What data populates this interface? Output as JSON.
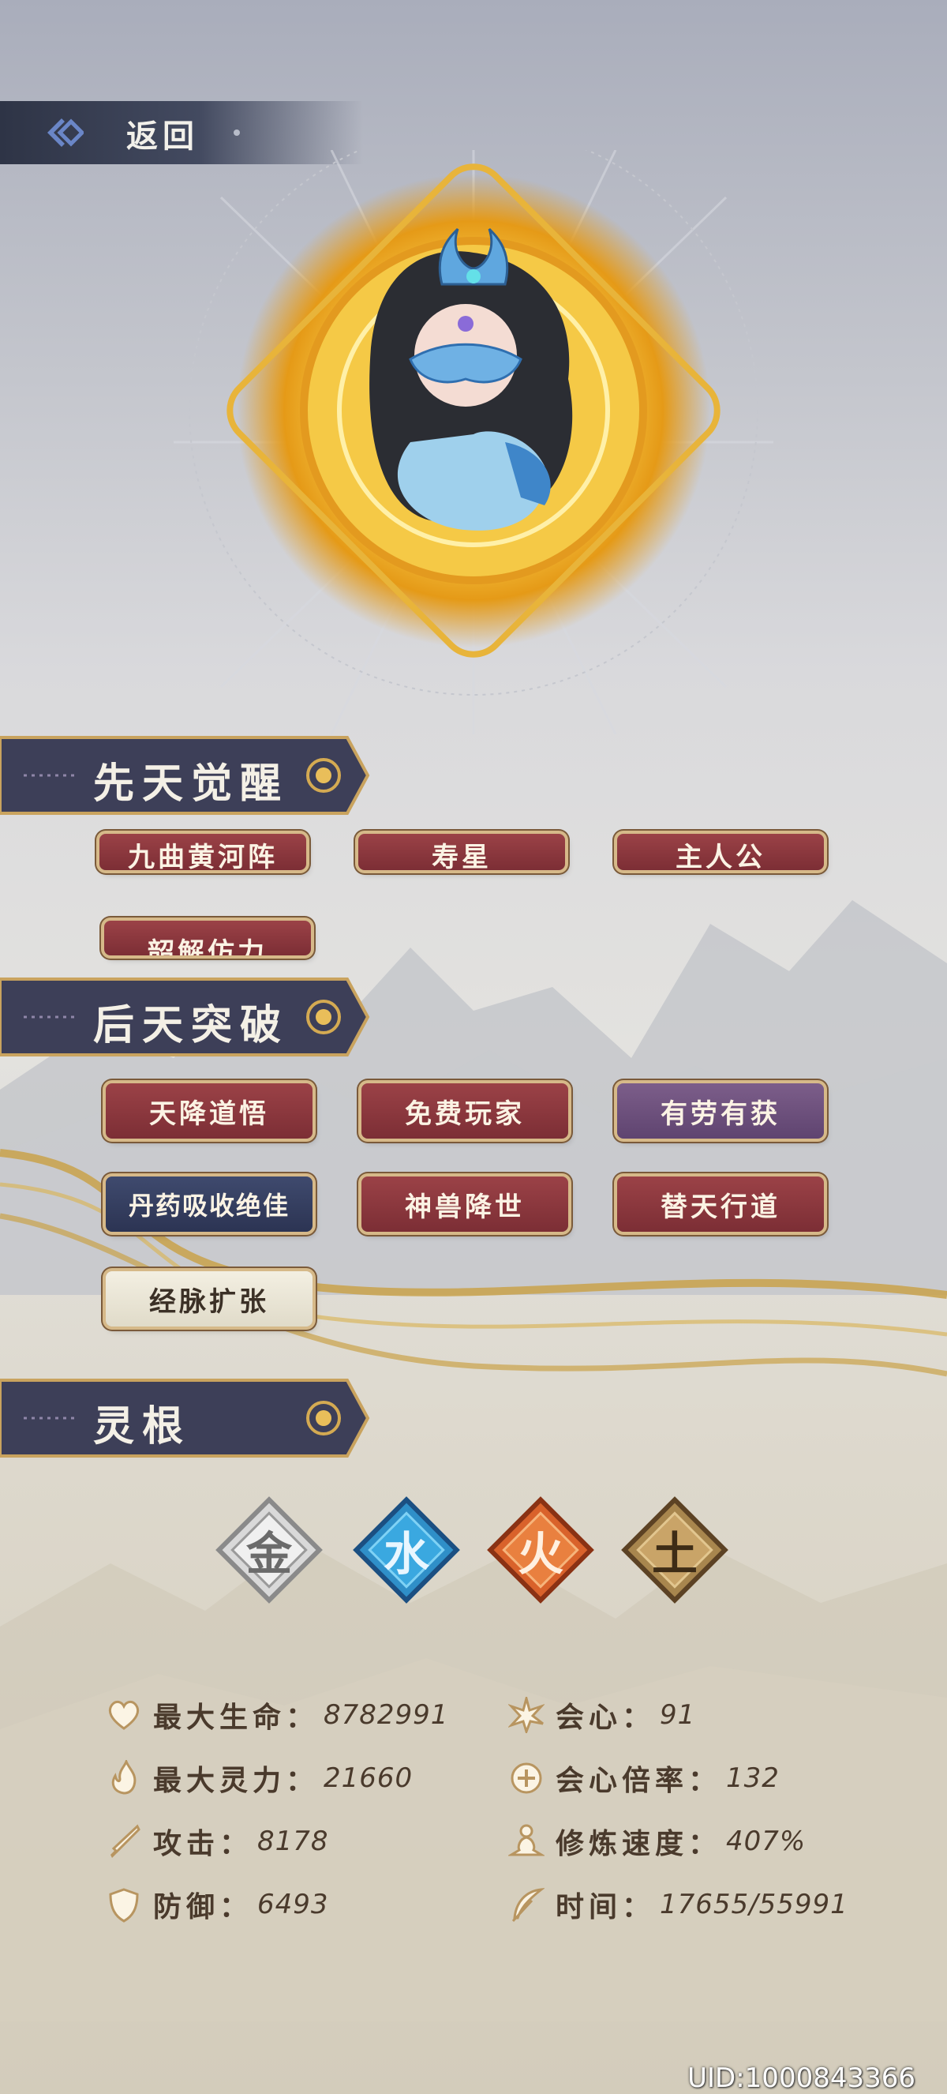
{
  "nav": {
    "back_label": "返回"
  },
  "sections": {
    "innate": "先天觉醒",
    "acquired": "后天突破",
    "spirit_root": "灵根"
  },
  "innate_skills": [
    {
      "label": "九曲黄河阵",
      "style": "red"
    },
    {
      "label": "寿星",
      "style": "red"
    },
    {
      "label": "主人公",
      "style": "red"
    },
    {
      "label": "韶解仿力",
      "style": "red"
    }
  ],
  "acquired_skills": [
    {
      "label": "天降道悟",
      "style": "red"
    },
    {
      "label": "免费玩家",
      "style": "red"
    },
    {
      "label": "有劳有获",
      "style": "purple"
    },
    {
      "label": "丹药吸收绝佳",
      "style": "navy"
    },
    {
      "label": "神兽降世",
      "style": "red"
    },
    {
      "label": "替天行道",
      "style": "red"
    },
    {
      "label": "经脉扩张",
      "style": "cream"
    }
  ],
  "elements": [
    {
      "char": "金",
      "color": "#a7a7a7"
    },
    {
      "char": "水",
      "color": "#2f8fc8"
    },
    {
      "char": "火",
      "color": "#d9622b"
    },
    {
      "char": "土",
      "color": "#a8864e"
    }
  ],
  "stats_left": [
    {
      "icon": "heart-icon",
      "label": "最大生命：",
      "value": "8782991"
    },
    {
      "icon": "flame-icon",
      "label": "最大灵力：",
      "value": "21660"
    },
    {
      "icon": "sword-icon",
      "label": "攻击：",
      "value": "8178"
    },
    {
      "icon": "shield-icon",
      "label": "防御：",
      "value": "6493"
    }
  ],
  "stats_right": [
    {
      "icon": "burst-icon",
      "label": "会心：",
      "value": "91"
    },
    {
      "icon": "crit-ring-icon",
      "label": "会心倍率：",
      "value": "132"
    },
    {
      "icon": "meditate-icon",
      "label": "修炼速度：",
      "value": "407%"
    },
    {
      "icon": "feather-icon",
      "label": "时间：",
      "value": "17655/55991"
    }
  ],
  "uid": "UID:1000843366"
}
